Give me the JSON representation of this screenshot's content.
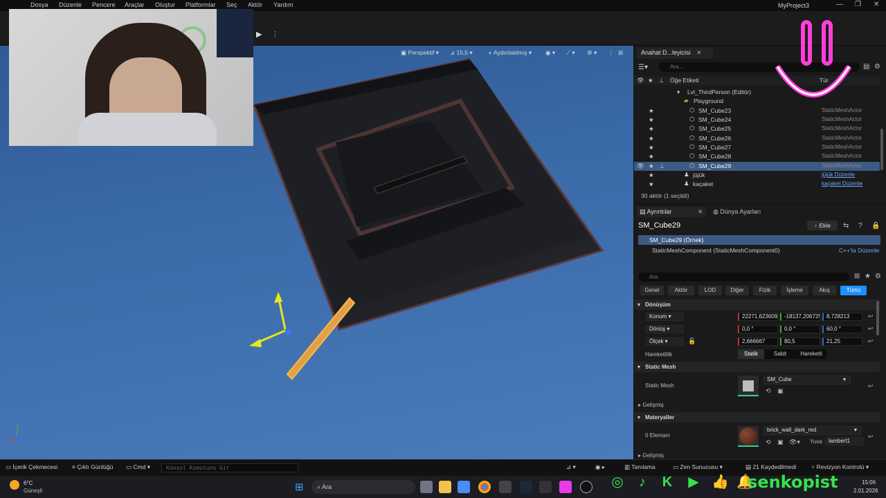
{
  "menu": [
    "Dosya",
    "Düzenle",
    "Pencere",
    "Araçlar",
    "Oluştur",
    "Platformlar",
    "Seç",
    "Aktör",
    "Yardım"
  ],
  "project_title": "MyProject3",
  "viewport": {
    "perspective": "Perspektif",
    "fov": "15,5",
    "lighting": "Aydınlatılmış"
  },
  "outliner": {
    "tab": "Anahat D...leyicisi",
    "search_placeholder": "Ara...",
    "col_label": "Öğe Etiketi",
    "col_type": "Tür",
    "rows": [
      {
        "label": "Lvl_ThirdPerson (Editör)",
        "type": ""
      },
      {
        "label": "Playground",
        "type": ""
      },
      {
        "label": "SM_Cube23",
        "type": "StaticMeshActor"
      },
      {
        "label": "SM_Cube24",
        "type": "StaticMeshActor"
      },
      {
        "label": "SM_Cube25",
        "type": "StaticMeshActor"
      },
      {
        "label": "SM_Cube26",
        "type": "StaticMeshActor"
      },
      {
        "label": "SM_Cube27",
        "type": "StaticMeshActor"
      },
      {
        "label": "SM_Cube28",
        "type": "StaticMeshActor"
      },
      {
        "label": "SM_Cube29",
        "type": "StaticMeshActor"
      },
      {
        "label": "jüjük",
        "type": "jüjük Düzenle"
      },
      {
        "label": "kaçaket",
        "type": "kaçaket Düzenle"
      }
    ],
    "count": "30 aktör (1 seçildi)"
  },
  "details": {
    "tab_details": "Ayrıntılar",
    "tab_world": "Dünya Ayarları",
    "actor_name": "SM_Cube29",
    "add_button": "Ekle",
    "instance": "SM_Cube29 (Örnek)",
    "component": "StaticMeshComponent (StaticMeshComponent0)",
    "cpp_link": "C++'ta Düzenle",
    "search_placeholder": "Ara",
    "filters": [
      "Genel",
      "Aktör",
      "LOD",
      "Diğer",
      "Fizik",
      "İşleme",
      "Akış",
      "Tümü"
    ],
    "transform_header": "Dönüşüm",
    "location_label": "Konum",
    "location": [
      "22271,623609",
      "-18137,206725",
      "8,728213"
    ],
    "rotation_label": "Dönüş",
    "rotation": [
      "0,0 °",
      "0,0 °",
      "60,0 °"
    ],
    "scale_label": "Ölçek",
    "scale": [
      "2,666667",
      "80,5",
      "21,25"
    ],
    "mobility_label": "Hareketlilik",
    "mobility": [
      "Statik",
      "Sabit",
      "Hareketli"
    ],
    "static_mesh_header": "Static Mesh",
    "static_mesh_label": "Static Mesh",
    "static_mesh_value": "SM_Cube",
    "advanced": "Gelişmiş",
    "materials_header": "Materyaller",
    "element_label": "0 Elemanı",
    "material_value": "brick_wall_dark_red",
    "slot_label": "Yuva",
    "slot_value": "lambert1",
    "advanced2": "Gelişmiş"
  },
  "statusbar": {
    "content_drawer": "İçerik Çekmecesi",
    "output_log": "Çıktı Günlüğü",
    "cmd": "Cmd",
    "console_placeholder": "Konsol Komutunu Gir",
    "trace": "Tanılama",
    "zen": "Zen Sunucusu",
    "unsaved": "21 Kaydedilmedi",
    "revision": "Revizyon Kontrolü"
  },
  "taskbar": {
    "weather_temp": "6°C",
    "weather_desc": "Güneşli",
    "search": "Ara",
    "time": "15:06",
    "date": "2.01.2026"
  },
  "overlay": {
    "social_handle": "senkopist"
  },
  "colors": {
    "accent": "#1e8fff",
    "selection": "#3d5a83",
    "social_green": "#37e14a",
    "logo_pink": "#ff3fd8"
  }
}
